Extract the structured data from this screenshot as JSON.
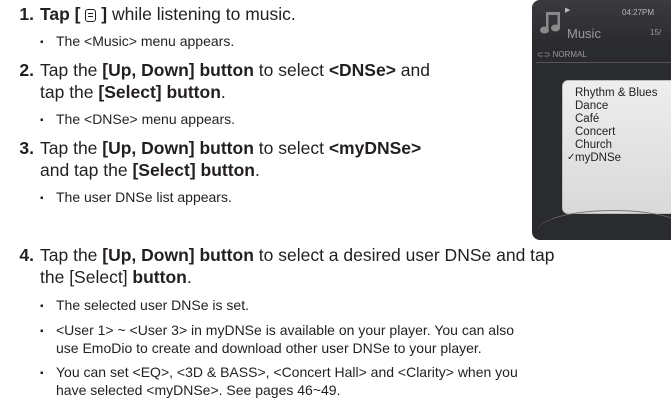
{
  "steps": [
    {
      "number": "1.",
      "text_before": "Tap [",
      "icon": "menu-icon",
      "text_after": "] while listening to music.",
      "notes": [
        "The <Music> menu appears."
      ]
    },
    {
      "number": "2.",
      "line1_pre": "Tap the ",
      "line1_bold": "[Up, Down] button",
      "line1_mid": " to select ",
      "line1_bold2": "<DNSe>",
      "line1_post": " and",
      "line2_pre": "tap the ",
      "line2_bold": "[Select] button",
      "line2_post": ".",
      "notes": [
        "The <DNSe> menu appears."
      ]
    },
    {
      "number": "3.",
      "line1_pre": "Tap the ",
      "line1_bold": "[Up, Down] button",
      "line1_mid": " to select ",
      "line1_bold2": "<myDNSe>",
      "line2_pre": "and tap the ",
      "line2_bold": "[Select] button",
      "line2_post": ".",
      "notes": [
        "The user DNSe list appears."
      ]
    },
    {
      "number": "4.",
      "line1_pre": "Tap the ",
      "line1_bold": "[Up, Down] button",
      "line1_post": " to select a desired user DNSe and  tap",
      "line2_pre": "the [Select] ",
      "line2_bold": "button",
      "line2_post": ".",
      "notes": [
        "The selected user DNSe is set.",
        "<User 1> ~ <User 3> in myDNSe is available on your player. You can also",
        "use EmoDio to create and download other user DNSe to your player.",
        "You can set <EQ>, <3D & BASS>, <Concert Hall> and <Clarity> when you",
        "have selected <myDNSe>. See pages 46~49."
      ]
    }
  ],
  "device": {
    "time": "04:27PM",
    "title": "Music",
    "count": "15/",
    "mode": "NORMAL",
    "menu_items": [
      "Rhythm & Blues",
      "Dance",
      "Café",
      "Concert",
      "Church",
      "myDNSe"
    ],
    "selected_item": "myDNSe",
    "check_mark": "✓"
  }
}
